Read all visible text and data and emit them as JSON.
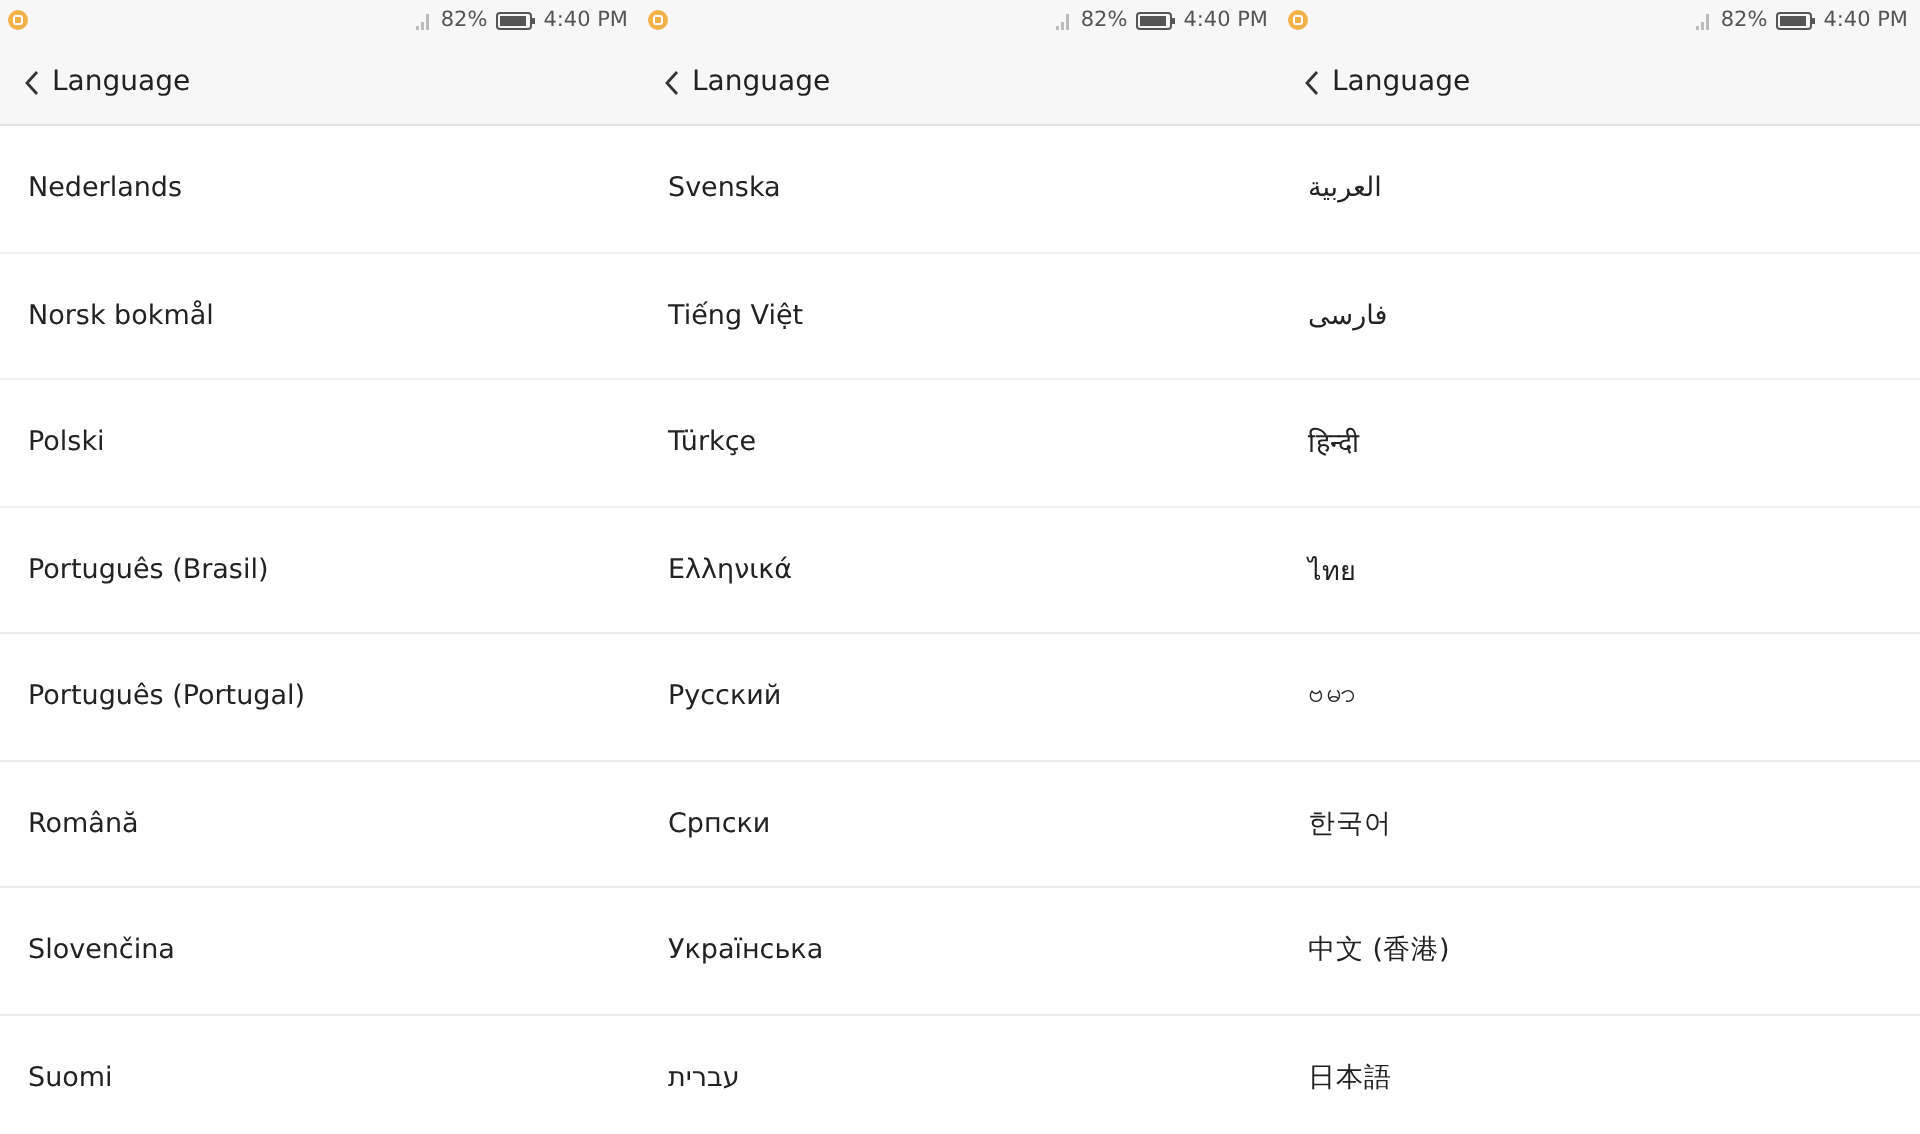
{
  "screens": [
    {
      "status_bar": {
        "battery": "82%",
        "time": "4:40 PM"
      },
      "title": "Language",
      "items": [
        "Nederlands",
        "Norsk bokmål",
        "Polski",
        "Português (Brasil)",
        "Português (Portugal)",
        "Română",
        "Slovenčina",
        "Suomi"
      ]
    },
    {
      "status_bar": {
        "battery": "82%",
        "time": "4:40 PM"
      },
      "title": "Language",
      "items": [
        "Svenska",
        "Tiếng Việt",
        "Türkçe",
        "Ελληνικά",
        "Русский",
        "Српски",
        "Українська",
        "עברית"
      ]
    },
    {
      "status_bar": {
        "battery": "82%",
        "time": "4:40 PM"
      },
      "title": "Language",
      "items": [
        "العربية",
        "فارسی",
        "हिन्दी",
        "ไทย",
        "ဗမာ",
        "한국어",
        "中文 (香港)",
        "日本語"
      ]
    }
  ]
}
